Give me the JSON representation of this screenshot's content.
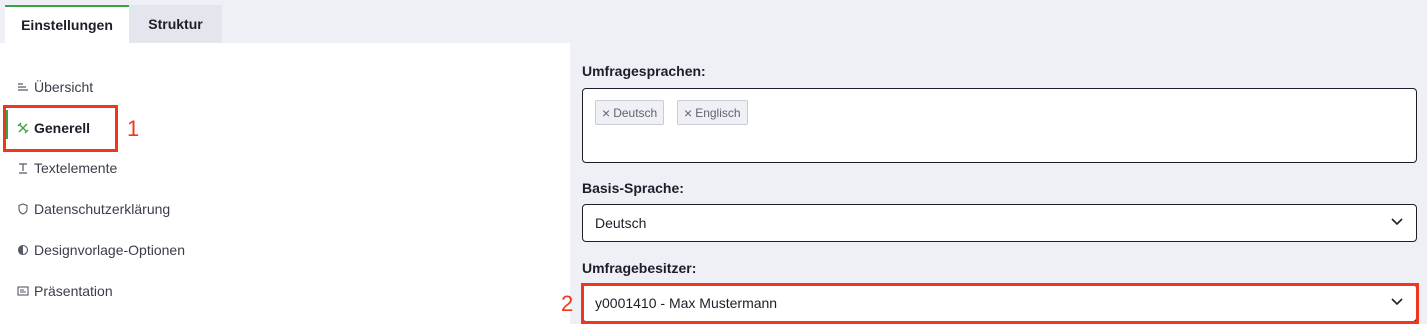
{
  "tabs": [
    {
      "label": "Einstellungen",
      "active": true
    },
    {
      "label": "Struktur",
      "active": false
    }
  ],
  "sidebar": {
    "items": [
      {
        "label": "Übersicht",
        "icon": "list-icon"
      },
      {
        "label": "Generell",
        "icon": "tools-icon",
        "active": true
      },
      {
        "label": "Textelemente",
        "icon": "text-icon"
      },
      {
        "label": "Datenschutzerklärung",
        "icon": "shield-icon"
      },
      {
        "label": "Designvorlage-Optionen",
        "icon": "contrast-icon"
      },
      {
        "label": "Präsentation",
        "icon": "presentation-icon"
      }
    ]
  },
  "form": {
    "languages": {
      "label": "Umfragesprachen:",
      "chips": [
        "Deutsch",
        "Englisch"
      ]
    },
    "base_language": {
      "label": "Basis-Sprache:",
      "value": "Deutsch"
    },
    "owner": {
      "label": "Umfragebesitzer:",
      "value": "y0001410 - Max Mustermann"
    }
  },
  "annotations": {
    "one": "1",
    "two": "2",
    "color": "#f0361c"
  },
  "colors": {
    "accent": "#3aa346",
    "page_bg": "#eef0f6"
  }
}
